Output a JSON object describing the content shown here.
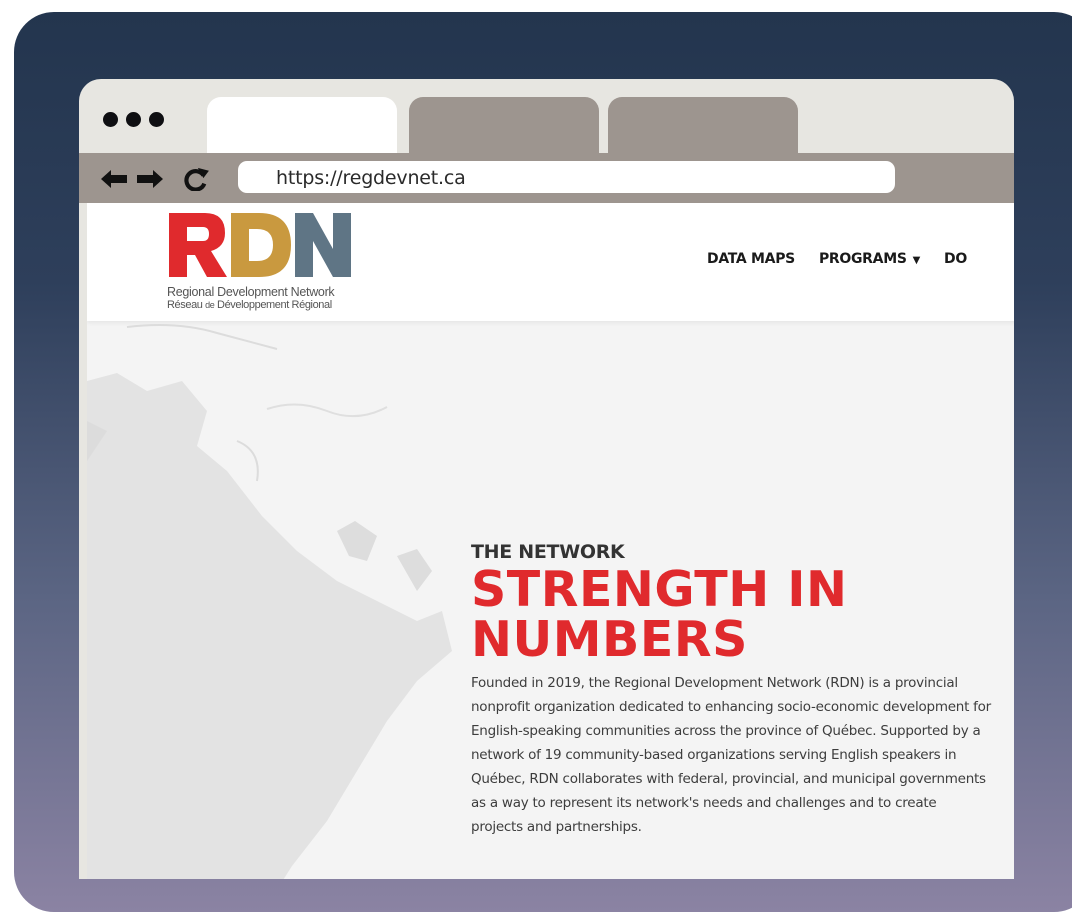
{
  "browser": {
    "url": "https://regdevnet.ca",
    "tabs": [
      {
        "label": "",
        "active": true
      },
      {
        "label": "",
        "active": false
      },
      {
        "label": "",
        "active": false
      }
    ],
    "icons": [
      "window-dots-icon",
      "back-arrow-icon",
      "forward-arrow-icon",
      "reload-icon"
    ]
  },
  "site": {
    "logo": {
      "letters": [
        "R",
        "D",
        "N"
      ],
      "colors": [
        "#e02a2d",
        "#c9993f",
        "#5f7585"
      ],
      "subtitle_en": "Regional Development Network",
      "subtitle_fr_prefix": "Réseau",
      "subtitle_fr_de": "de",
      "subtitle_fr_rest": "Développement Régional"
    },
    "nav": [
      {
        "label": "DATA MAPS",
        "dropdown": false
      },
      {
        "label": "PROGRAMS",
        "dropdown": true
      },
      {
        "label": "DO",
        "dropdown": false
      }
    ],
    "hero": {
      "eyebrow": "THE NETWORK",
      "headline_line1": "STRENGTH IN",
      "headline_line2": "NUMBERS",
      "body": "Founded in 2019, the Regional Development Network (RDN) is a provincial nonprofit organization dedicated to enhancing socio-economic development for English-speaking communities across the province of Québec. Supported by a network of 19 community-based organizations serving English speakers in Québec, RDN collaborates with federal, provincial, and municipal governments as a way to represent its network's needs and challenges and to create projects and partnerships."
    }
  },
  "colors": {
    "accent_red": "#e02a2d",
    "backdrop_top": "#23354e",
    "backdrop_bottom": "#8b83a3",
    "tab_inactive": "#9d958f",
    "chrome": "#e7e6e1"
  }
}
